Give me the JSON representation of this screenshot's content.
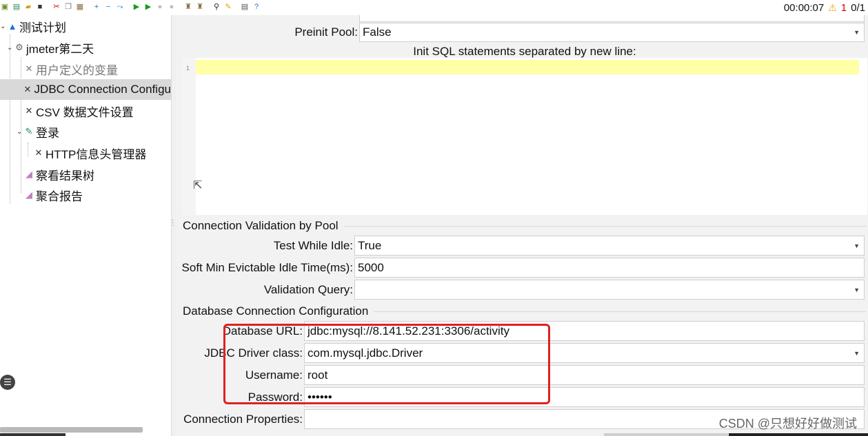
{
  "toolbar": {
    "elapsed_time": "00:00:07",
    "warning_count": "1",
    "thread_ratio": "0/1"
  },
  "tree": {
    "items": [
      {
        "label": "测试计划"
      },
      {
        "label": "jmeter第二天"
      },
      {
        "label": "用户定义的变量"
      },
      {
        "label": "JDBC Connection Configu"
      },
      {
        "label": "CSV 数据文件设置"
      },
      {
        "label": "登录"
      },
      {
        "label": "HTTP信息头管理器"
      },
      {
        "label": "察看结果树"
      },
      {
        "label": "聚合报告"
      }
    ]
  },
  "form": {
    "preinit_pool": {
      "label": "Preinit Pool:",
      "value": "False"
    },
    "init_sql": {
      "label": "Init SQL statements separated by new line:",
      "line_number": "1"
    },
    "validation_section": "Connection Validation by Pool",
    "test_while_idle": {
      "label": "Test While Idle:",
      "value": "True"
    },
    "soft_min_idle": {
      "label": "Soft Min Evictable Idle Time(ms):",
      "value": "5000"
    },
    "validation_query": {
      "label": "Validation Query:",
      "value": ""
    },
    "db_section": "Database Connection Configuration",
    "database_url": {
      "label": "Database URL:",
      "value": "jdbc:mysql://8.141.52.231:3306/activity"
    },
    "driver_class": {
      "label": "JDBC Driver class:",
      "value": "com.mysql.jdbc.Driver"
    },
    "username": {
      "label": "Username:",
      "value": "root"
    },
    "password": {
      "label": "Password:",
      "value": "••••••"
    },
    "connection_properties": {
      "label": "Connection Properties:",
      "value": ""
    }
  },
  "watermark": "CSDN @只想好好做测试",
  "colors": {
    "selection": "#d9d9d9",
    "highlight_line": "#ffffa6",
    "annotation_box": "#e02020",
    "warning": "#e0a800",
    "error": "#d00000"
  }
}
